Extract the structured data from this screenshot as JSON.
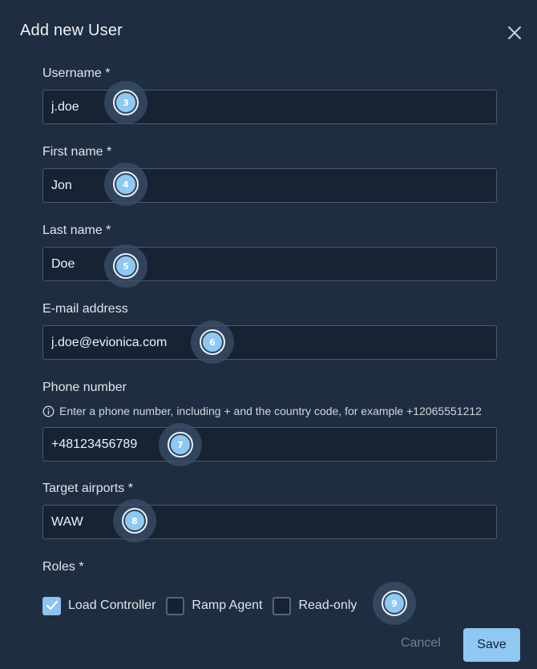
{
  "dialog": {
    "title": "Add new User"
  },
  "fields": {
    "username": {
      "label": "Username *",
      "value": "j.doe"
    },
    "first_name": {
      "label": "First name *",
      "value": "Jon"
    },
    "last_name": {
      "label": "Last name *",
      "value": "Doe"
    },
    "email": {
      "label": "E-mail address",
      "value": "j.doe@evionica.com"
    },
    "phone": {
      "label": "Phone number",
      "hint": "Enter a phone number, including + and the country code, for example +12065551212",
      "value": "+48123456789"
    },
    "airports": {
      "label": "Target airports *",
      "value": "WAW"
    }
  },
  "roles": {
    "label": "Roles *",
    "options": [
      {
        "label": "Load Controller",
        "checked": true
      },
      {
        "label": "Ramp Agent",
        "checked": false
      },
      {
        "label": "Read-only",
        "checked": false
      }
    ]
  },
  "markers": [
    "3",
    "4",
    "5",
    "6",
    "7",
    "8",
    "9"
  ],
  "actions": {
    "cancel": "Cancel",
    "save": "Save"
  },
  "colors": {
    "background": "#1f2d40",
    "accent": "#8fc8f2",
    "input_bg": "#172233"
  }
}
